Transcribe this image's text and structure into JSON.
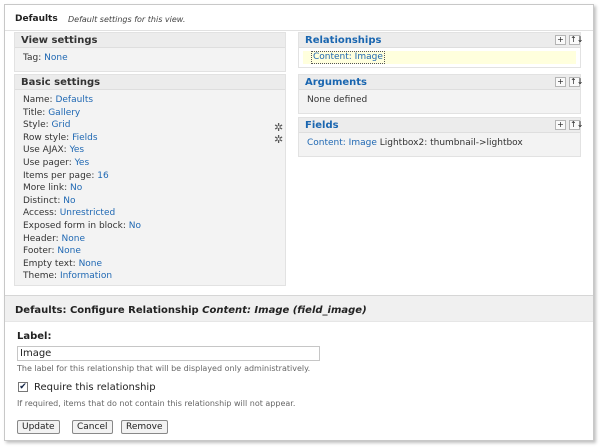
{
  "topbar": {
    "title": "Defaults",
    "subtitle": "Default settings for this view."
  },
  "view_settings": {
    "title": "View settings",
    "tag_label": "Tag:",
    "tag_value": "None"
  },
  "basic_settings": {
    "title": "Basic settings",
    "items": [
      {
        "label": "Name:",
        "value": "Defaults"
      },
      {
        "label": "Title:",
        "value": "Gallery"
      },
      {
        "label": "Style:",
        "value": "Grid"
      },
      {
        "label": "Row style:",
        "value": "Fields"
      },
      {
        "label": "Use AJAX:",
        "value": "Yes"
      },
      {
        "label": "Use pager:",
        "value": "Yes"
      },
      {
        "label": "Items per page:",
        "value": "16"
      },
      {
        "label": "More link:",
        "value": "No"
      },
      {
        "label": "Distinct:",
        "value": "No"
      },
      {
        "label": "Access:",
        "value": "Unrestricted"
      },
      {
        "label": "Exposed form in block:",
        "value": "No"
      },
      {
        "label": "Header:",
        "value": "None"
      },
      {
        "label": "Footer:",
        "value": "None"
      },
      {
        "label": "Empty text:",
        "value": "None"
      },
      {
        "label": "Theme:",
        "value": "Information"
      }
    ]
  },
  "relationships": {
    "title": "Relationships",
    "item": "Content: Image"
  },
  "arguments": {
    "title": "Arguments",
    "empty": "None defined"
  },
  "fields": {
    "title": "Fields",
    "item_link": "Content: Image",
    "item_text": "Lightbox2: thumbnail->lightbox"
  },
  "buttons": {
    "add": "+",
    "rearrange": "↑↓"
  },
  "configure": {
    "heading_prefix": "Defaults: Configure Relationship",
    "heading_em": "Content: Image (field_image)",
    "label": "Label:",
    "input_value": "Image",
    "input_desc": "The label for this relationship that will be displayed only administratively.",
    "checkbox_label": "Require this relationship",
    "checkbox_desc": "If required, items that do not contain this relationship will not appear.",
    "update": "Update",
    "cancel": "Cancel",
    "remove": "Remove"
  },
  "colors": {
    "link": "#1f68b3",
    "highlight": "#ffffdd",
    "panel_bg": "#f3f3f3"
  }
}
